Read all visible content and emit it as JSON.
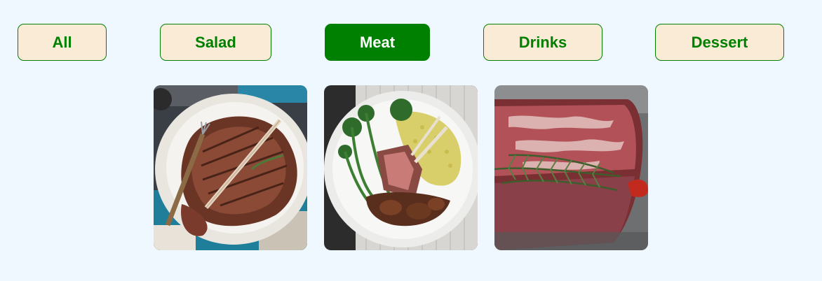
{
  "filters": [
    {
      "label": "All",
      "active": false
    },
    {
      "label": "Salad",
      "active": false
    },
    {
      "label": "Meat",
      "active": true
    },
    {
      "label": "Drinks",
      "active": false
    },
    {
      "label": "Dessert",
      "active": false
    }
  ],
  "active_color": "#008000",
  "inactive_background": "#faebd7",
  "page_background": "#f0f8ff",
  "items": [
    {
      "image": "t-bone-steak-on-platter-image"
    },
    {
      "image": "rack-of-lamb-with-broccoli-and-couscous-image"
    },
    {
      "image": "raw-steak-with-rosemary-image"
    }
  ]
}
